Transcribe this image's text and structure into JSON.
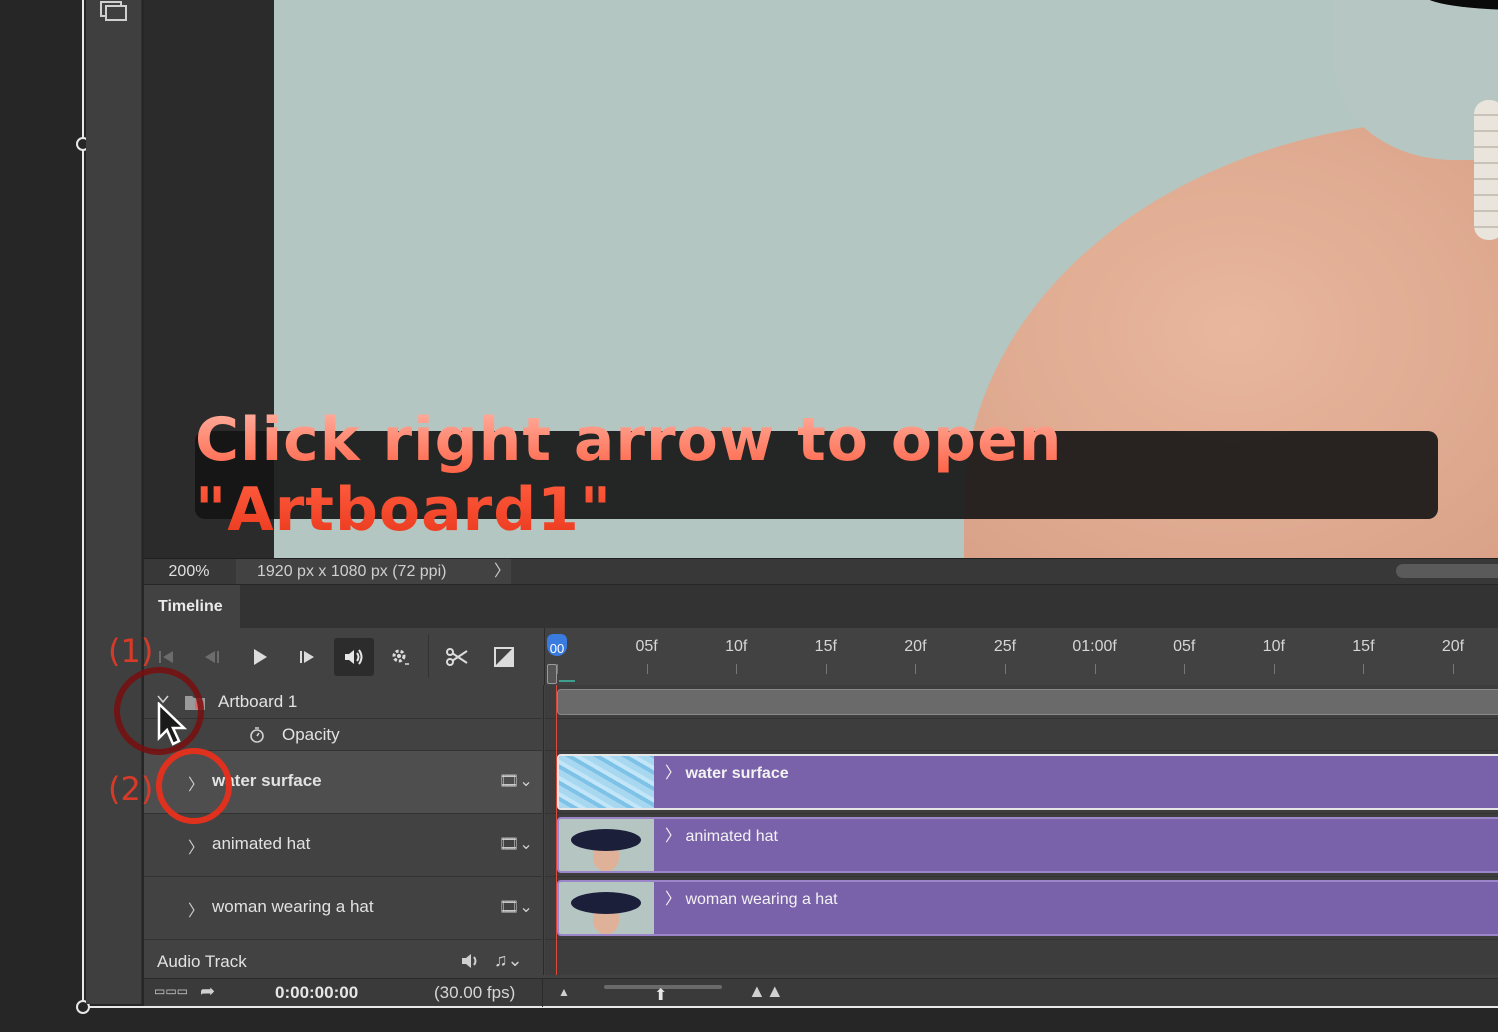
{
  "caption": "Click right arrow to open \"Artboard1\"",
  "status": {
    "zoom": "200%",
    "doc_size": "1920 px x 1080 px (72 ppi)",
    "arrow": "〉"
  },
  "panel": {
    "tab": "Timeline"
  },
  "ruler": {
    "labels": [
      "00",
      "05f",
      "10f",
      "15f",
      "20f",
      "25f",
      "01:00f",
      "05f",
      "10f",
      "15f",
      "20f"
    ]
  },
  "layers": {
    "artboard": "Artboard 1",
    "opacity": "Opacity",
    "rows": [
      {
        "name": "water surface"
      },
      {
        "name": "animated hat"
      },
      {
        "name": "woman wearing a hat"
      }
    ]
  },
  "clips": [
    "water surface",
    "animated hat",
    "woman wearing a hat"
  ],
  "audio": {
    "label": "Audio Track"
  },
  "bottom": {
    "timecode": "0:00:00:00",
    "fps": "(30.00 fps)"
  },
  "annotations": {
    "one": "(1)",
    "two": "(2)"
  },
  "colors": {
    "clip": "#7a62ab",
    "annotation": "#d83a28",
    "playhead": "#3a7be0"
  }
}
